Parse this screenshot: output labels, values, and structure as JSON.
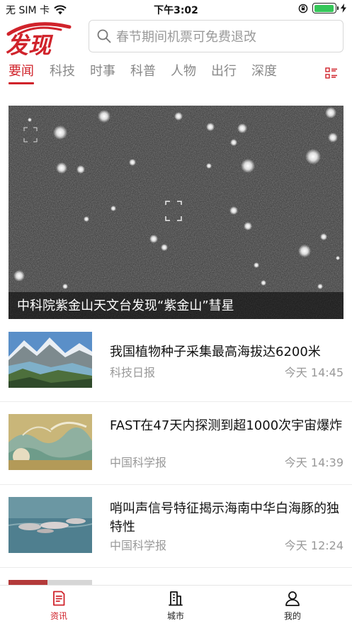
{
  "status_bar": {
    "carrier": "无 SIM 卡",
    "time": "下午3:02",
    "battery_level": 0.95
  },
  "header": {
    "logo_text": "发现",
    "search_placeholder": "春节期间机票可免费退改"
  },
  "tabs": [
    {
      "label": "要闻",
      "active": true
    },
    {
      "label": "科技",
      "active": false
    },
    {
      "label": "时事",
      "active": false
    },
    {
      "label": "科普",
      "active": false
    },
    {
      "label": "人物",
      "active": false
    },
    {
      "label": "出行",
      "active": false
    },
    {
      "label": "深度",
      "active": false
    }
  ],
  "hero": {
    "caption": "中科院紫金山天文台发现“紫金山”彗星"
  },
  "news": [
    {
      "title": "我国植物种子采集最高海拔达6200米",
      "source": "科技日报",
      "time": "今天 14:45"
    },
    {
      "title": "FAST在47天内探测到超1000次宇宙爆炸",
      "source": "中国科学报",
      "time": "今天 14:39"
    },
    {
      "title": "哨叫声信号特征揭示海南中华白海豚的独特性",
      "source": "中国科学报",
      "time": "今天 12:24"
    }
  ],
  "tabbar": [
    {
      "label": "资讯",
      "icon": "news-icon",
      "active": true
    },
    {
      "label": "城市",
      "icon": "city-icon",
      "active": false
    },
    {
      "label": "我的",
      "icon": "profile-icon",
      "active": false
    }
  ],
  "colors": {
    "accent": "#d0232b",
    "muted_text": "#999999",
    "battery_green": "#35c759"
  }
}
